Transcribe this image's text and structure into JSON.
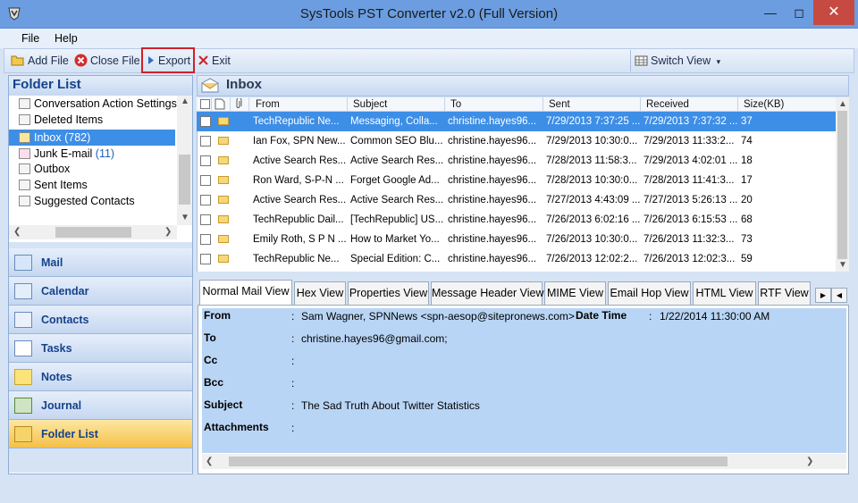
{
  "window": {
    "title": "SysTools PST Converter v2.0 (Full Version)"
  },
  "menu": [
    "File",
    "Help"
  ],
  "toolbar": {
    "add_file": "Add File",
    "close_file": "Close File",
    "export": "Export",
    "exit": "Exit",
    "switch_view": "Switch View"
  },
  "folder_panel": {
    "header": "Folder List",
    "items": [
      {
        "label": "Conversation Action Settings",
        "count": ""
      },
      {
        "label": "Deleted Items",
        "count": ""
      },
      {
        "label": "Inbox",
        "count": "(782)"
      },
      {
        "label": "Junk E-mail",
        "count": "(11)"
      },
      {
        "label": "Outbox",
        "count": ""
      },
      {
        "label": "Sent Items",
        "count": ""
      },
      {
        "label": "Suggested Contacts",
        "count": ""
      }
    ]
  },
  "nav": [
    "Mail",
    "Calendar",
    "Contacts",
    "Tasks",
    "Notes",
    "Journal",
    "Folder List"
  ],
  "inbox": {
    "title": "Inbox",
    "columns": [
      "From",
      "Subject",
      "To",
      "Sent",
      "Received",
      "Size(KB)"
    ],
    "rows": [
      {
        "from": "TechRepublic Ne...",
        "subject": "Messaging, Colla...",
        "to": "christine.hayes96...",
        "sent": "7/29/2013 7:37:25 ...",
        "received": "7/29/2013 7:37:32 ...",
        "size": "37"
      },
      {
        "from": "Ian Fox, SPN New...",
        "subject": "Common SEO Blu...",
        "to": "christine.hayes96...",
        "sent": "7/29/2013 10:30:0...",
        "received": "7/29/2013 11:33:2...",
        "size": "74"
      },
      {
        "from": "Active Search Res...",
        "subject": "Active Search Res...",
        "to": "christine.hayes96...",
        "sent": "7/28/2013 11:58:3...",
        "received": "7/29/2013 4:02:01 ...",
        "size": "18"
      },
      {
        "from": "Ron Ward, S-P-N ...",
        "subject": "Forget Google Ad...",
        "to": "christine.hayes96...",
        "sent": "7/28/2013 10:30:0...",
        "received": "7/28/2013 11:41:3...",
        "size": "17"
      },
      {
        "from": "Active Search Res...",
        "subject": "Active Search Res...",
        "to": "christine.hayes96...",
        "sent": "7/27/2013 4:43:09 ...",
        "received": "7/27/2013 5:26:13 ...",
        "size": "20"
      },
      {
        "from": "TechRepublic Dail...",
        "subject": "[TechRepublic] US...",
        "to": "christine.hayes96...",
        "sent": "7/26/2013 6:02:16 ...",
        "received": "7/26/2013 6:15:53 ...",
        "size": "68"
      },
      {
        "from": "Emily Roth, S P N ...",
        "subject": "How to Market Yo...",
        "to": "christine.hayes96...",
        "sent": "7/26/2013 10:30:0...",
        "received": "7/26/2013 11:32:3...",
        "size": "73"
      },
      {
        "from": "TechRepublic Ne...",
        "subject": "Special Edition: C...",
        "to": "christine.hayes96...",
        "sent": "7/26/2013 12:02:2...",
        "received": "7/26/2013 12:02:3...",
        "size": "59"
      }
    ]
  },
  "tabs": [
    "Normal Mail View",
    "Hex View",
    "Properties View",
    "Message Header View",
    "MIME View",
    "Email Hop View",
    "HTML View",
    "RTF View"
  ],
  "detail": {
    "from_label": "From",
    "from_value": "Sam Wagner, SPNNews <spn-aesop@sitepronews.com>",
    "date_label": "Date Time",
    "date_value": "1/22/2014 11:30:00 AM",
    "to_label": "To",
    "to_value": "christine.hayes96@gmail.com;",
    "cc_label": "Cc",
    "bcc_label": "Bcc",
    "subject_label": "Subject",
    "subject_value": "The Sad Truth About Twitter Statistics",
    "attachments_label": "Attachments",
    "colon": ":"
  }
}
